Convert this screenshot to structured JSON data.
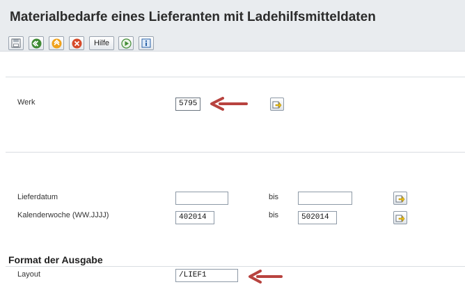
{
  "window": {
    "title": "Materialbedarfe eines Lieferanten mit Ladehilfsmitteldaten"
  },
  "toolbar": {
    "buttons": [
      {
        "name": "save",
        "icon": "save-icon"
      },
      {
        "name": "back",
        "icon": "back-icon"
      },
      {
        "name": "exit",
        "icon": "exit-icon"
      },
      {
        "name": "cancel",
        "icon": "cancel-icon"
      },
      {
        "name": "help",
        "label": "Hilfe"
      },
      {
        "name": "execute",
        "icon": "execute-icon"
      },
      {
        "name": "info",
        "icon": "info-icon"
      }
    ]
  },
  "form": {
    "werk": {
      "label": "Werk",
      "value": "5795"
    },
    "lieferdatum": {
      "label": "Lieferdatum",
      "from": "",
      "bis_label": "bis",
      "to": ""
    },
    "kalenderwoche": {
      "label": "Kalenderwoche (WW.JJJJ)",
      "from": "402014",
      "bis_label": "bis",
      "to": "502014"
    }
  },
  "output_format": {
    "heading": "Format der Ausgabe",
    "layout": {
      "label": "Layout",
      "value": "/LIEF1"
    }
  },
  "colors": {
    "annotation_arrow": "#b8433f",
    "background": "#ffffff",
    "bar": "#e9ecef"
  }
}
